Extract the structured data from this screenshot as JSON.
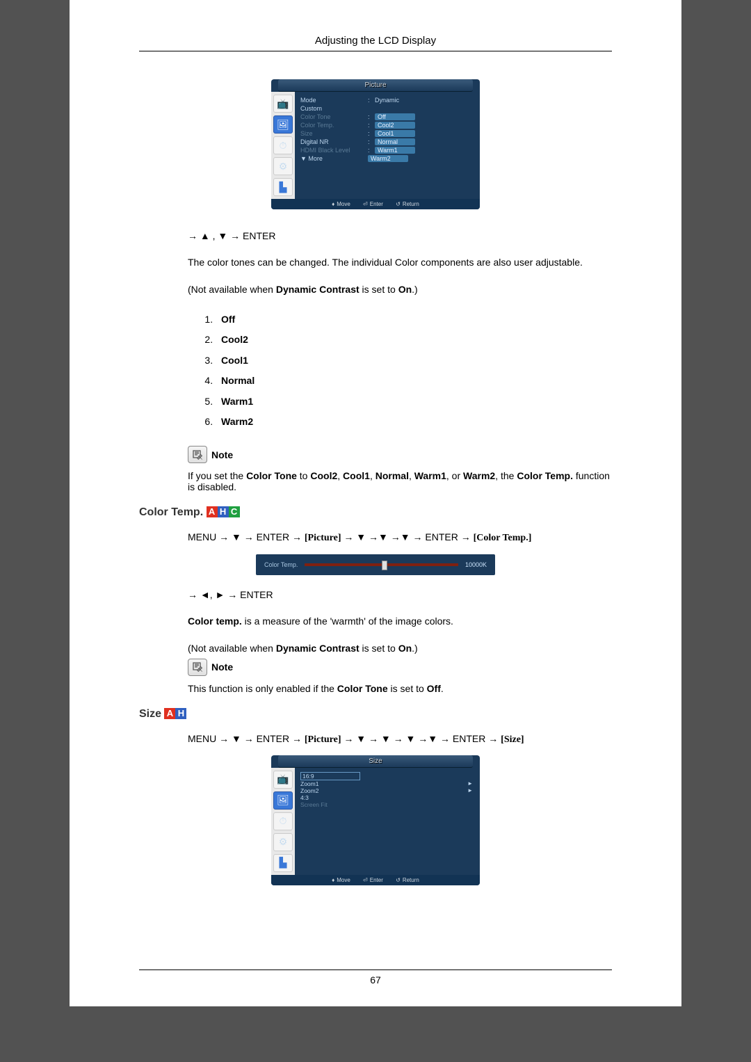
{
  "header": {
    "title": "Adjusting the LCD Display"
  },
  "osd_picture": {
    "title": "Picture",
    "rows": [
      {
        "label": "Mode",
        "sep": ":",
        "value": "Dynamic",
        "dim": false,
        "hl": false
      },
      {
        "label": "Custom",
        "sep": "",
        "value": "",
        "dim": false,
        "hl": false
      },
      {
        "label": "Color Tone",
        "sep": ":",
        "value": "Off",
        "dim": true,
        "hl": true
      },
      {
        "label": "Color Temp.",
        "sep": ":",
        "value": "Cool2",
        "dim": true,
        "hl": true
      },
      {
        "label": "Size",
        "sep": ":",
        "value": "Cool1",
        "dim": true,
        "hl": true
      },
      {
        "label": "Digital NR",
        "sep": ":",
        "value": "Normal",
        "dim": false,
        "hl": true
      },
      {
        "label": "HDMI Black Level",
        "sep": ":",
        "value": "Warm1",
        "dim": true,
        "hl": true
      },
      {
        "label": "▼ More",
        "sep": "",
        "value": "Warm2",
        "dim": false,
        "hl": true
      }
    ],
    "footer": {
      "move": "Move",
      "enter": "Enter",
      "ret": "Return"
    }
  },
  "nav1": "→ ▲ , ▼ → ENTER",
  "para1": "The color tones can be changed. The individual Color components are also user adjustable.",
  "para2_a": "(Not available when ",
  "para2_b": "Dynamic Contrast",
  "para2_c": " is set to ",
  "para2_d": "On",
  "para2_e": ".)",
  "options": [
    "Off",
    "Cool2",
    "Cool1",
    "Normal",
    "Warm1",
    "Warm2"
  ],
  "note_label": "Note",
  "note1_a": "If you set the ",
  "note1_b": "Color Tone",
  "note1_c": " to ",
  "note1_d": "Cool2",
  "note1_e": ", ",
  "note1_f": "Cool1",
  "note1_g": ", ",
  "note1_h": "Normal",
  "note1_i": ", ",
  "note1_j": "Warm1",
  "note1_k": ", or ",
  "note1_l": "Warm2",
  "note1_m": ", the ",
  "note1_n": "Color Temp.",
  "note1_o": " function is disabled.",
  "section_colortemp": "Color Temp.",
  "badges_ct": {
    "a": "A",
    "h": "H",
    "c": "C"
  },
  "path_ct_a": "MENU → ▼ → ENTER → ",
  "path_ct_b": "[Picture]",
  "path_ct_c": " → ▼ →▼ →▼ → ENTER → ",
  "path_ct_d": "[Color Temp.]",
  "slider": {
    "label": "Color Temp.",
    "value": "10000K"
  },
  "nav2": "→ ◄, ► → ENTER",
  "ct_para_a": "Color temp.",
  "ct_para_b": " is a measure of the 'warmth' of the image colors.",
  "ct_note_a": "This function is only enabled if the ",
  "ct_note_b": "Color Tone",
  "ct_note_c": " is set to ",
  "ct_note_d": "Off",
  "ct_note_e": ".",
  "section_size": "Size",
  "badges_size": {
    "a": "A",
    "h": "H"
  },
  "path_size_a": "MENU → ▼ → ENTER → ",
  "path_size_b": "[Picture]",
  "path_size_c": " → ▼ → ▼ → ▼ →▼ → ENTER → ",
  "path_size_d": "[Size]",
  "osd_size": {
    "title": "Size",
    "items": [
      {
        "label": "16:9",
        "boxed": true,
        "arrow": false,
        "dim": false
      },
      {
        "label": "Zoom1",
        "boxed": false,
        "arrow": true,
        "dim": false
      },
      {
        "label": "Zoom2",
        "boxed": false,
        "arrow": true,
        "dim": false
      },
      {
        "label": "4:3",
        "boxed": false,
        "arrow": false,
        "dim": false
      },
      {
        "label": "Screen Fit",
        "boxed": false,
        "arrow": false,
        "dim": true
      }
    ],
    "footer": {
      "move": "Move",
      "enter": "Enter",
      "ret": "Return"
    }
  },
  "page_number": "67"
}
